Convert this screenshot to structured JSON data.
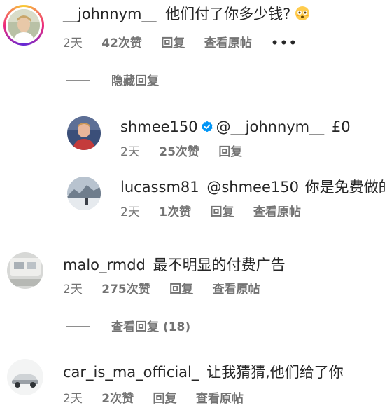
{
  "comments": [
    {
      "username": "__johnnym__",
      "text": "他们付了你多少钱?",
      "emoji": "flushed-face",
      "time": "2天",
      "likes": "42次赞",
      "reply": "回复",
      "view_post": "查看原帖",
      "more": "•••",
      "toggle": "隐藏回复",
      "replies": [
        {
          "username": "shmee150",
          "verified": true,
          "mention": "@__johnnym__",
          "text": "£0",
          "time": "2天",
          "likes": "25次赞",
          "reply": "回复"
        },
        {
          "username": "lucassm81",
          "mention": "@shmee150",
          "text": "你是免费做的?",
          "time": "2天",
          "likes": "1次赞",
          "reply": "回复",
          "view_post": "查看原帖"
        }
      ]
    },
    {
      "username": "malo_rmdd",
      "text": "最不明显的付费广告",
      "time": "2天",
      "likes": "275次赞",
      "reply": "回复",
      "view_post": "查看原帖",
      "toggle": "查看回复 (18)"
    },
    {
      "username": "car_is_ma_official_",
      "text": "让我猜猜,他们给了你",
      "time": "2天",
      "likes": "2次赞",
      "reply": "回复",
      "view_post": "查看原帖"
    }
  ],
  "colors": {
    "text": "#262626",
    "secondary": "#737373",
    "verified": "#0095f6"
  }
}
